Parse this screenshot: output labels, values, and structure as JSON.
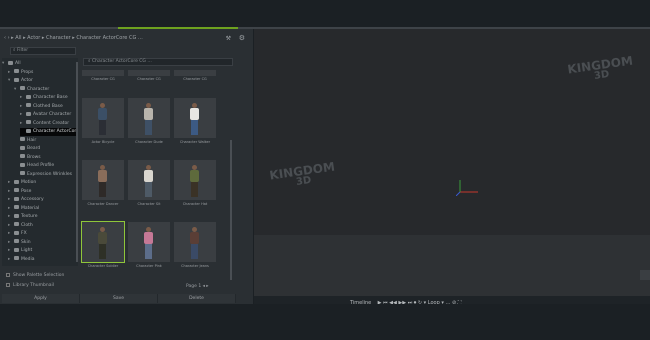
{
  "window": {
    "breadcrumb": "‹ › ▸ All ▸ Actor ▸ Character ▸ Character ActorCore CG …",
    "search_placeholder": "⌕  Filter",
    "thumb_search": "⌕  Character ActorCore CG …"
  },
  "tree": [
    {
      "label": "All",
      "indent": 0,
      "arrow": "▾"
    },
    {
      "label": "Props",
      "indent": 1,
      "arrow": "▸"
    },
    {
      "label": "Actor",
      "indent": 1,
      "arrow": "▾"
    },
    {
      "label": "Character",
      "indent": 2,
      "arrow": "▾"
    },
    {
      "label": "Character Base",
      "indent": 3,
      "arrow": "▸"
    },
    {
      "label": "Clothed Base",
      "indent": 3,
      "arrow": "▸"
    },
    {
      "label": "Avatar Character",
      "indent": 3,
      "arrow": "▸"
    },
    {
      "label": "Content Creator",
      "indent": 3,
      "arrow": "▸"
    },
    {
      "label": "Character ActorCore CG",
      "indent": 3,
      "arrow": "",
      "selected": true
    },
    {
      "label": "Hair",
      "indent": 2,
      "arrow": ""
    },
    {
      "label": "Beard",
      "indent": 2,
      "arrow": ""
    },
    {
      "label": "Brows",
      "indent": 2,
      "arrow": ""
    },
    {
      "label": "Head Profile",
      "indent": 2,
      "arrow": ""
    },
    {
      "label": "Expression Wrinkles",
      "indent": 2,
      "arrow": ""
    },
    {
      "label": "Motion",
      "indent": 1,
      "arrow": "▸"
    },
    {
      "label": "Pose",
      "indent": 1,
      "arrow": "▸"
    },
    {
      "label": "Accessory",
      "indent": 1,
      "arrow": "▸"
    },
    {
      "label": "Material",
      "indent": 1,
      "arrow": "▸"
    },
    {
      "label": "Texture",
      "indent": 1,
      "arrow": "▸"
    },
    {
      "label": "Cloth",
      "indent": 1,
      "arrow": "▸"
    },
    {
      "label": "FX",
      "indent": 1,
      "arrow": "▸"
    },
    {
      "label": "Skin",
      "indent": 1,
      "arrow": "▸"
    },
    {
      "label": "Light",
      "indent": 1,
      "arrow": "▸"
    },
    {
      "label": "Media",
      "indent": 1,
      "arrow": "▸"
    }
  ],
  "thumbs_top_row": [
    "Character CG",
    "Character CG",
    "Character CG"
  ],
  "thumbs": [
    {
      "label": "Actor Bicycle",
      "torso": "#3b4f66",
      "legs": "#2b2e35"
    },
    {
      "label": "Character Dude",
      "torso": "#b8b4ac",
      "legs": "#3e5066"
    },
    {
      "label": "Character Walker",
      "torso": "#e8e6e2",
      "legs": "#3c5a84"
    },
    {
      "label": "Character Dancer",
      "torso": "#8a6d5a",
      "legs": "#2e2a28"
    },
    {
      "label": "Character Sit",
      "torso": "#d9d6cf",
      "legs": "#4e5a66"
    },
    {
      "label": "Character Hat",
      "torso": "#5e6a3c",
      "legs": "#3a3226"
    },
    {
      "label": "Character Soldier",
      "torso": "#4a4a3a",
      "legs": "#2e3026",
      "selected": true
    },
    {
      "label": "Character Pink",
      "torso": "#c57896",
      "legs": "#5c6d8a"
    },
    {
      "label": "Character Jeans",
      "torso": "#5a3e36",
      "legs": "#3a4a66"
    }
  ],
  "pager": "Page 1 ◂ ▸",
  "options": {
    "check1": "Show Palette Selection",
    "check2": "Library Thumbnail"
  },
  "bottom_tabs": [
    "Apply",
    "Save",
    "Delete"
  ],
  "watermark": {
    "line1": "KINGDOM",
    "line2": "3D"
  },
  "transport": {
    "label": "Timeline",
    "icons": "▶  ⏮  ◀◀  ▶▶  ⏭  ⏺  ↻   ▾   Loop  ▾  …  ⊘   ⛶"
  },
  "colors": {
    "accent": "#6ea21f",
    "selection": "#8fc63a",
    "panel": "#2a2f33",
    "viewport": "#27292c"
  }
}
